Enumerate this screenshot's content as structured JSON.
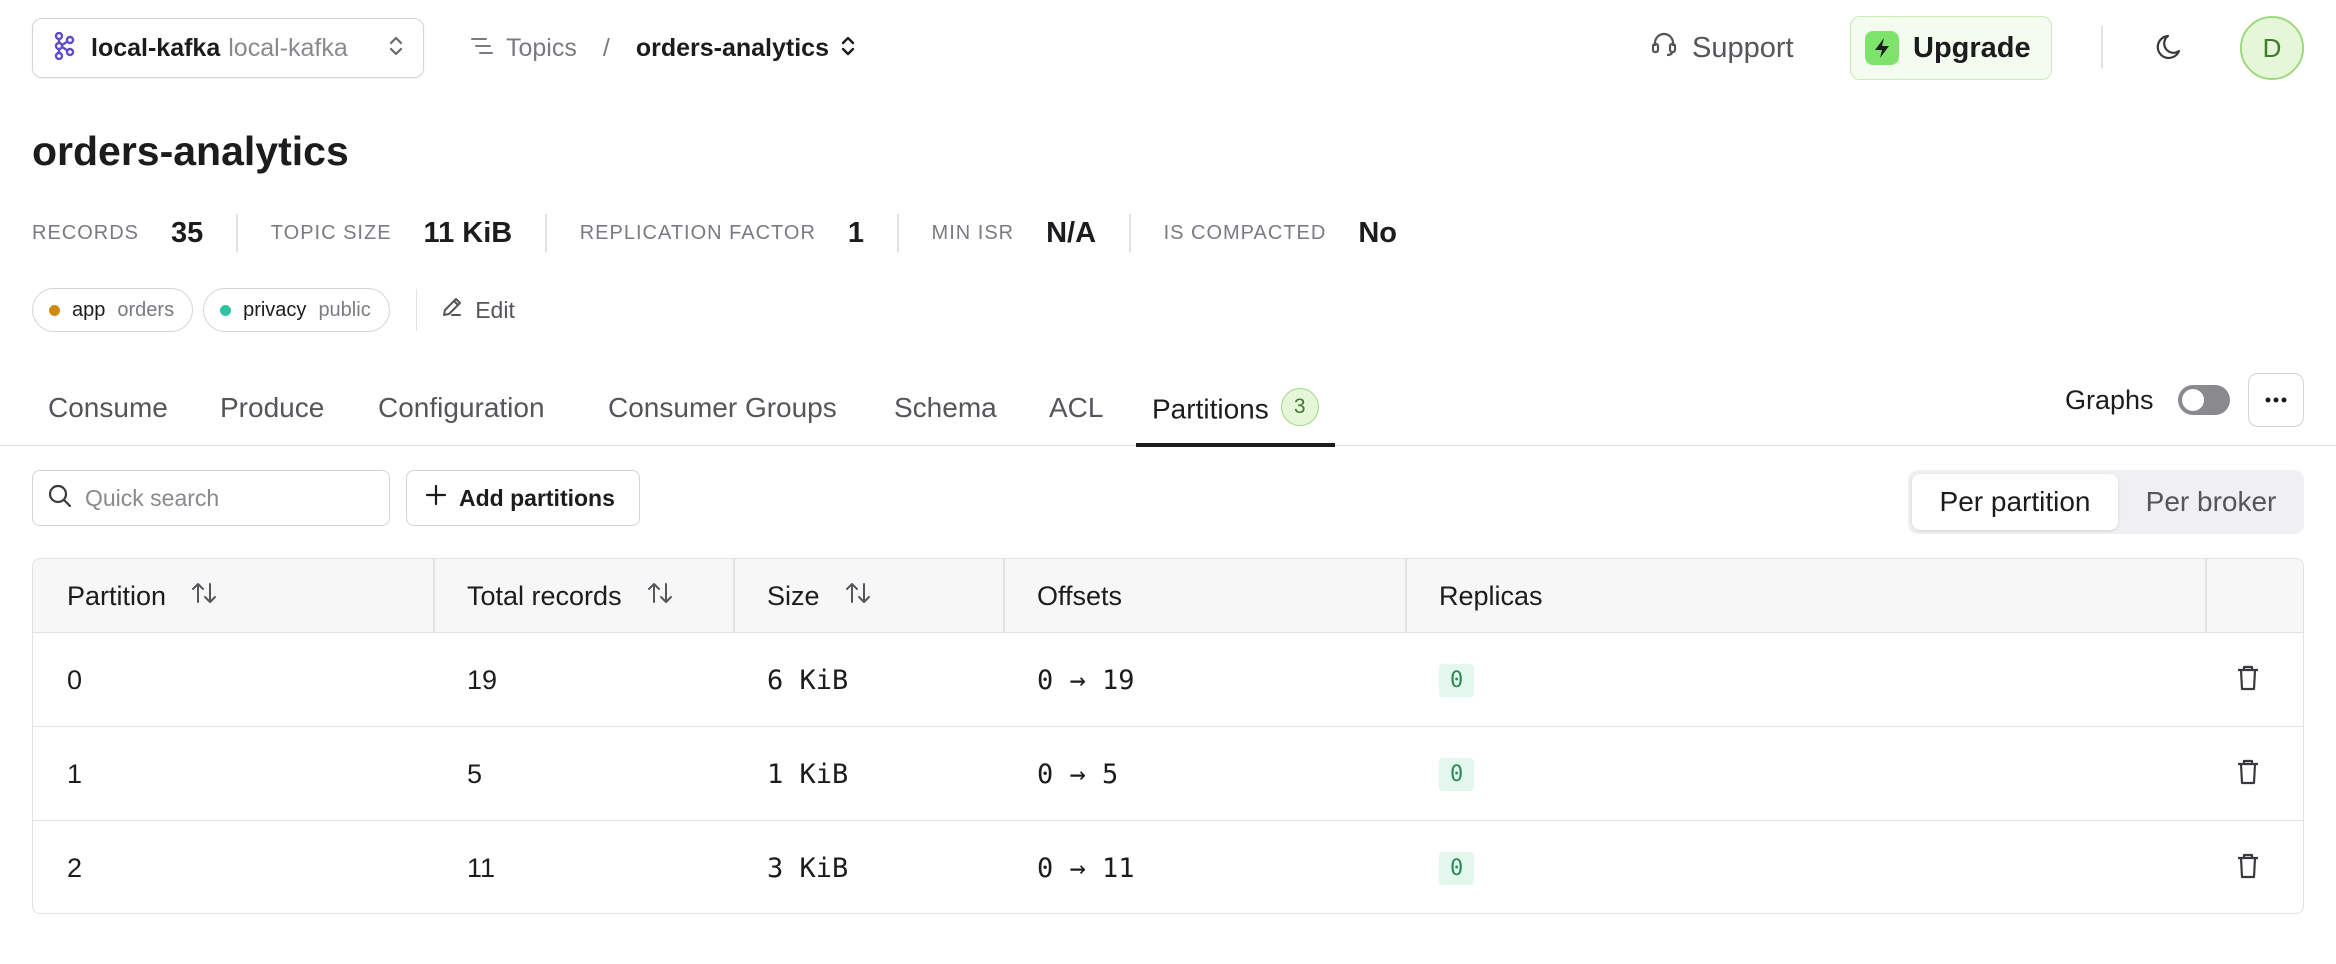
{
  "header": {
    "cluster_name": "local-kafka",
    "cluster_sub": "local-kafka",
    "breadcrumb_topics": "Topics",
    "breadcrumb_sep": "/",
    "breadcrumb_current": "orders-analytics",
    "support_label": "Support",
    "upgrade_label": "Upgrade",
    "avatar_initial": "D"
  },
  "topic": {
    "title": "orders-analytics",
    "stats": [
      {
        "label": "RECORDS",
        "value": "35"
      },
      {
        "label": "TOPIC SIZE",
        "value": "11 KiB"
      },
      {
        "label": "REPLICATION FACTOR",
        "value": "1"
      },
      {
        "label": "MIN ISR",
        "value": "N/A"
      },
      {
        "label": "IS COMPACTED",
        "value": "No"
      }
    ],
    "tags": [
      {
        "key": "app",
        "value": "orders",
        "color": "#d18b0c"
      },
      {
        "key": "privacy",
        "value": "public",
        "color": "#2ec4a0"
      }
    ],
    "edit_label": "Edit"
  },
  "tabs": [
    {
      "label": "Consume"
    },
    {
      "label": "Produce"
    },
    {
      "label": "Configuration"
    },
    {
      "label": "Consumer Groups"
    },
    {
      "label": "Schema"
    },
    {
      "label": "ACL"
    },
    {
      "label": "Partitions",
      "count": "3",
      "active": true
    }
  ],
  "graphs_label": "Graphs",
  "graphs_enabled": false,
  "toolbar": {
    "search_placeholder": "Quick search",
    "add_partitions_label": "Add partitions",
    "view_options": [
      "Per partition",
      "Per broker"
    ],
    "view_selected": "Per partition"
  },
  "table": {
    "columns": [
      "Partition",
      "Total records",
      "Size",
      "Offsets",
      "Replicas"
    ],
    "rows": [
      {
        "partition": "0",
        "total_records": "19",
        "size": "6 KiB",
        "offsets": "0 → 19",
        "replica": "0"
      },
      {
        "partition": "1",
        "total_records": "5",
        "size": "1 KiB",
        "offsets": "0 → 5",
        "replica": "0"
      },
      {
        "partition": "2",
        "total_records": "11",
        "size": "3 KiB",
        "offsets": "0 → 11",
        "replica": "0"
      }
    ]
  },
  "colors": {
    "accent_green": "#7de36a",
    "replica_bg": "#e4f7ec",
    "replica_text": "#2d8a57",
    "kafka_icon": "#5b4ec7"
  },
  "icons": {
    "cluster": "kafka-icon",
    "cluster_chevron": "chevron-updown-icon",
    "topics": "list-icon",
    "support": "headset-icon",
    "upgrade": "bolt-icon",
    "theme": "moon-icon",
    "edit": "pencil-icon",
    "search": "search-icon",
    "add": "plus-icon",
    "more": "ellipsis-icon",
    "sort": "sort-icon",
    "delete": "trash-icon"
  }
}
